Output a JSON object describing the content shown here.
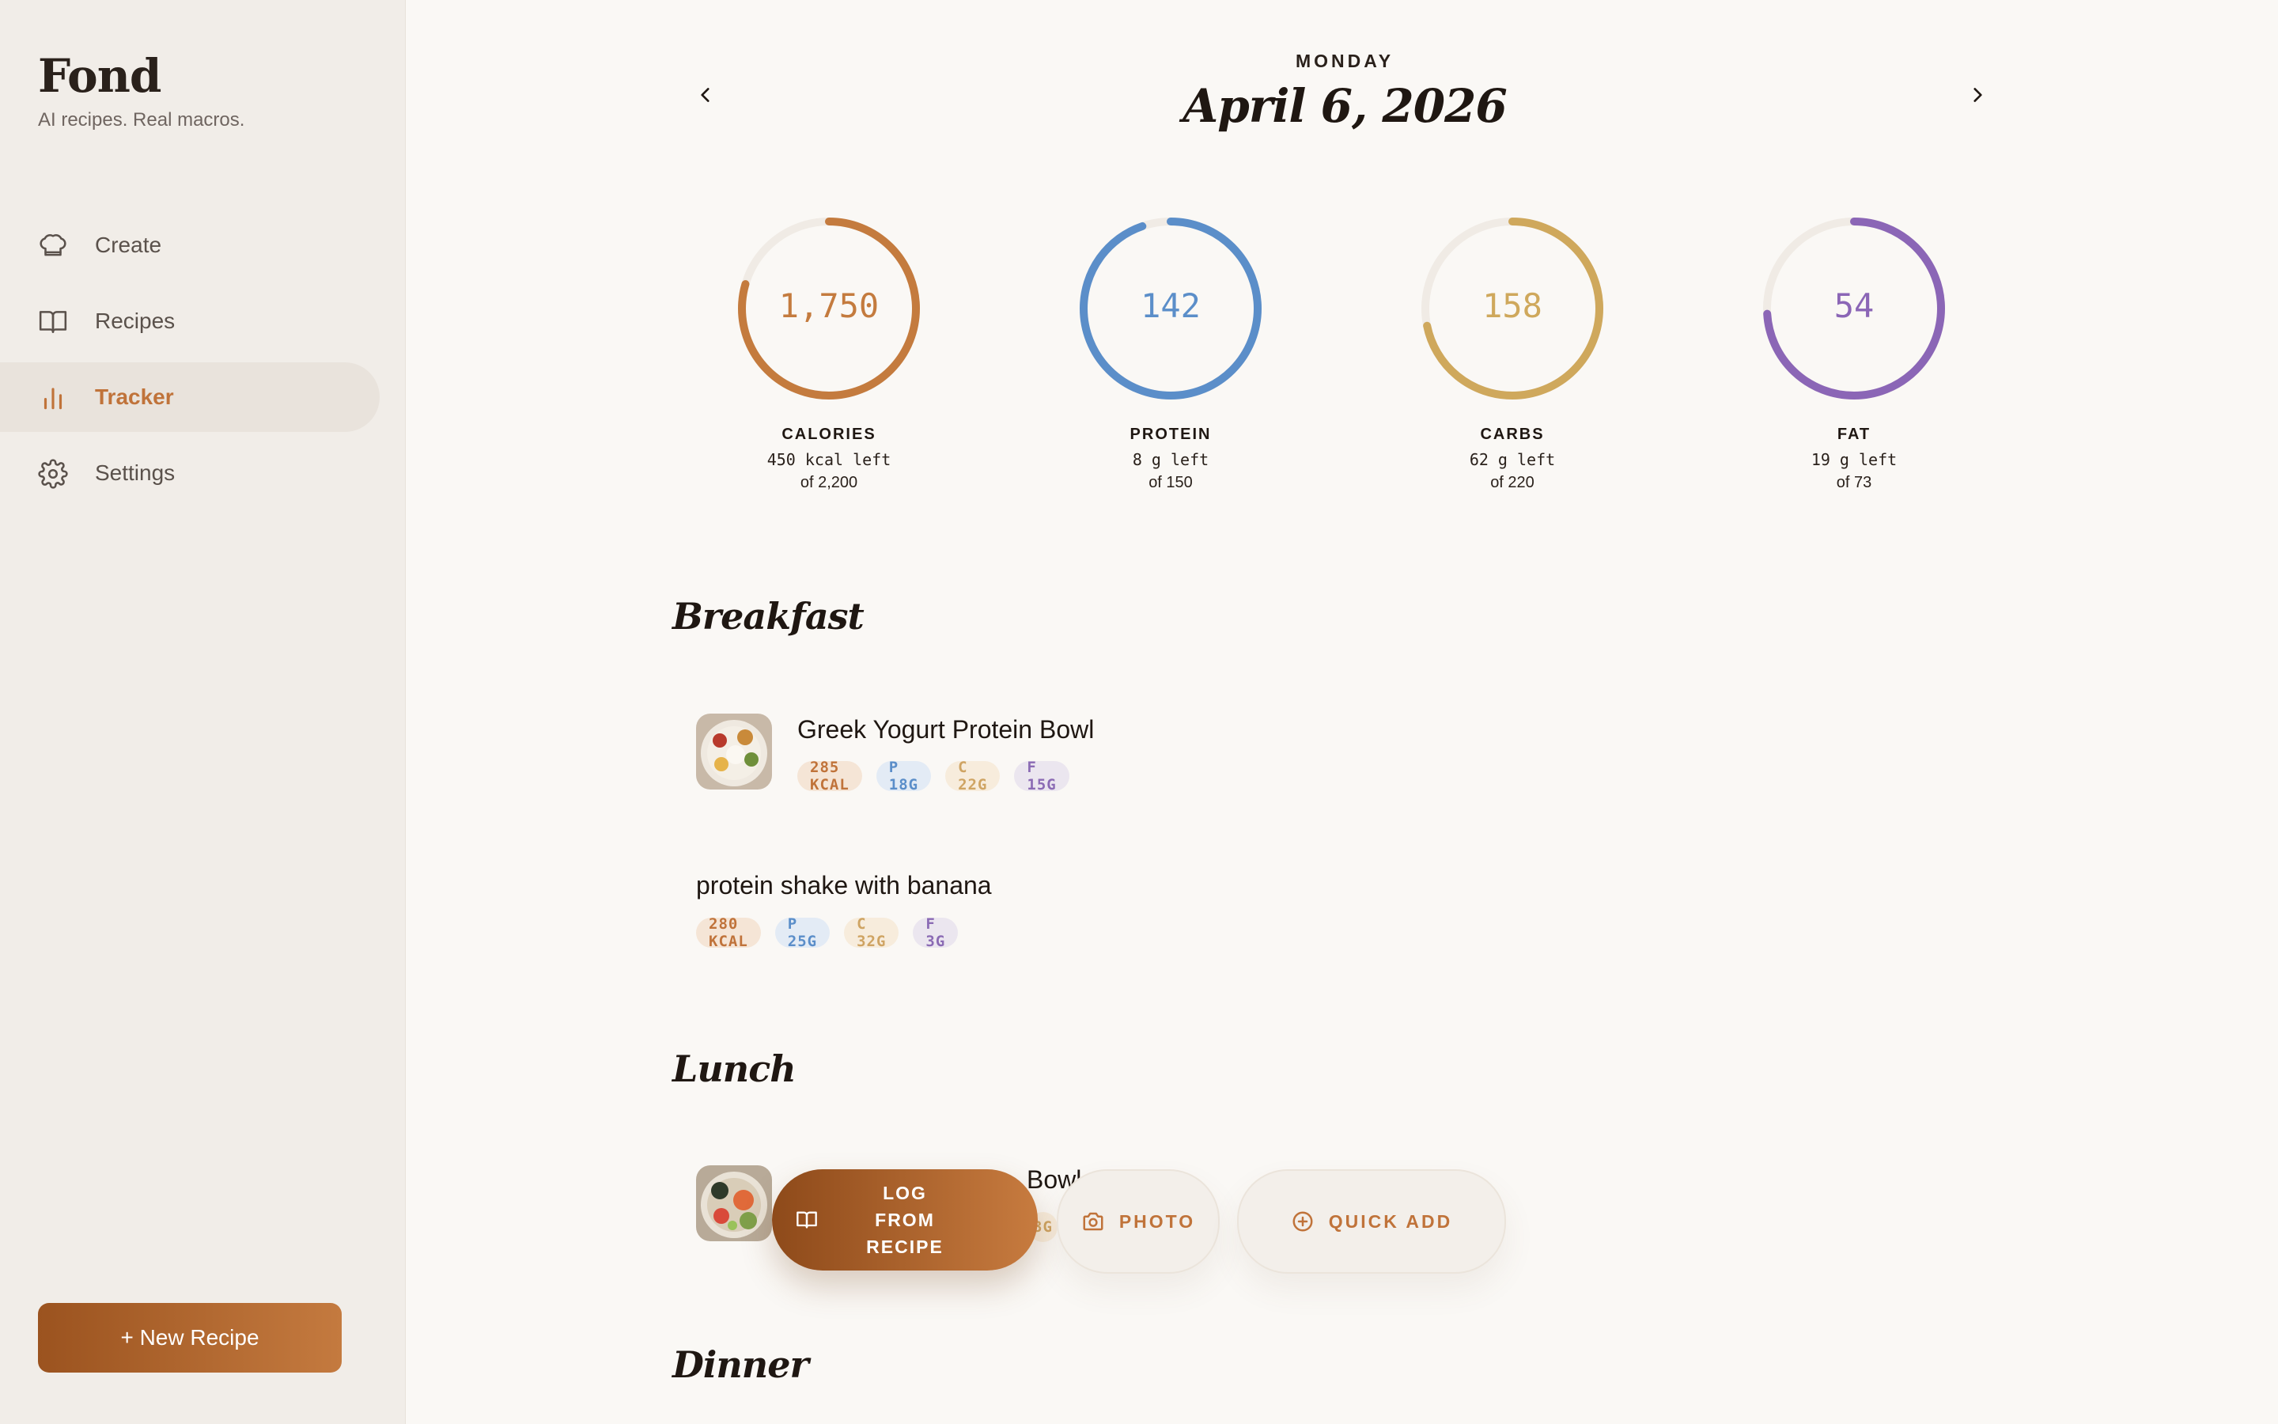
{
  "sidebar": {
    "brand": "Fond",
    "tagline": "AI recipes. Real macros.",
    "nav": [
      {
        "label": "Create",
        "icon": "chef-hat-icon"
      },
      {
        "label": "Recipes",
        "icon": "book-icon"
      },
      {
        "label": "Tracker",
        "icon": "bar-chart-icon",
        "active": true
      },
      {
        "label": "Settings",
        "icon": "gear-icon"
      }
    ],
    "new_recipe": "+ New Recipe"
  },
  "header": {
    "weekday": "MONDAY",
    "date": "April 6, 2026"
  },
  "rings": [
    {
      "name": "CALORIES",
      "value": "1,750",
      "left": "450 kcal left",
      "goal": "of 2,200",
      "fraction": 0.795,
      "color": "#c47b3e"
    },
    {
      "name": "PROTEIN",
      "value": "142",
      "left": "8 g left",
      "goal": "of 150",
      "fraction": 0.947,
      "color": "#5b8ec9"
    },
    {
      "name": "CARBS",
      "value": "158",
      "left": "62 g left",
      "goal": "of 220",
      "fraction": 0.718,
      "color": "#cfa85c"
    },
    {
      "name": "FAT",
      "value": "54",
      "left": "19 g left",
      "goal": "of 73",
      "fraction": 0.74,
      "color": "#8b66b6"
    }
  ],
  "meals": {
    "breakfast": {
      "title": "Breakfast",
      "entries": [
        {
          "name": "Greek Yogurt Protein Bowl",
          "kcal": "285 KCAL",
          "p": "P 18G",
          "c": "C 22G",
          "f": "F 15G"
        },
        {
          "name": "protein shake with banana",
          "kcal": "280 KCAL",
          "p": "P 25G",
          "c": "C 32G",
          "f": "F 3G"
        }
      ]
    },
    "lunch": {
      "title": "Lunch",
      "entries": [
        {
          "name": "Bowl",
          "partial_pill": "3G"
        }
      ]
    },
    "dinner": {
      "title": "Dinner"
    }
  },
  "actions": {
    "log_line1": "LOG FROM",
    "log_line2": "RECIPE",
    "photo": "PHOTO",
    "quick_add": "QUICK ADD"
  }
}
